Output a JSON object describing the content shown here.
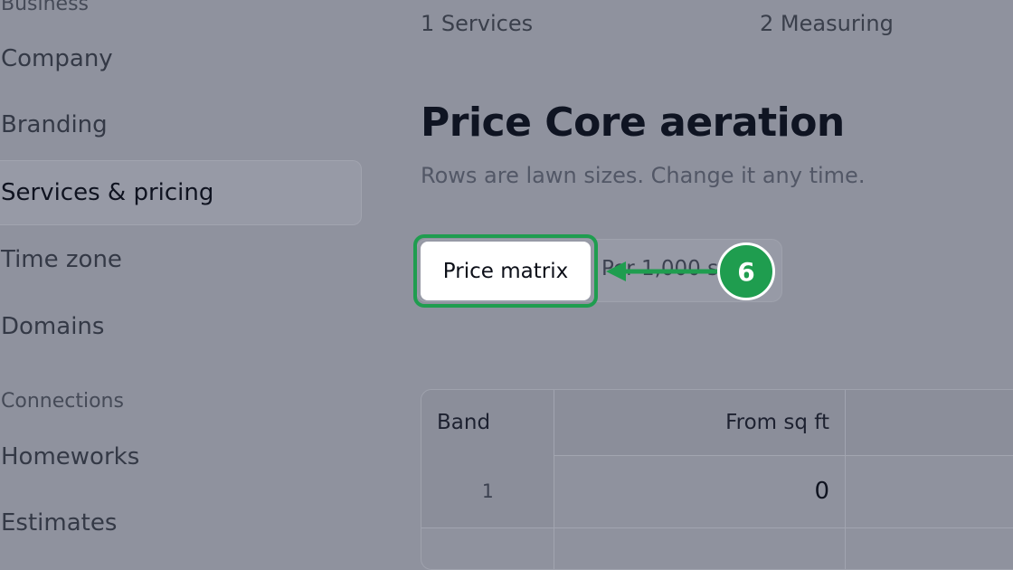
{
  "sidebar": {
    "group_business": "Business",
    "items_business": [
      "Company",
      "Branding",
      "Services & pricing",
      "Time zone",
      "Domains"
    ],
    "group_connections": "Connections",
    "items_connections": [
      "Homeworks",
      "Estimates"
    ],
    "active_item": "Services & pricing"
  },
  "steps": [
    {
      "number": "1",
      "label": "Services"
    },
    {
      "number": "2",
      "label": "Measuring"
    }
  ],
  "main": {
    "title": "Price Core aeration",
    "subtitle": "Rows are lawn sizes. Change it any time."
  },
  "tabs": {
    "active_label": "Price matrix",
    "inactive_label": "Per 1,000 sq ft"
  },
  "callout": {
    "number": "6",
    "color": "#1f9d4f"
  },
  "table": {
    "headers": [
      "Band",
      "From sq ft",
      ""
    ],
    "rows": [
      {
        "band": "1",
        "from": "0",
        "price": ""
      }
    ]
  }
}
